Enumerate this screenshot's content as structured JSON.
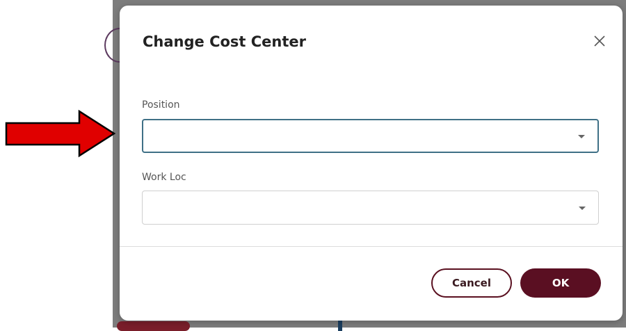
{
  "modal": {
    "title": "Change Cost Center",
    "close_icon": "close-icon",
    "fields": [
      {
        "label": "Position",
        "value": "",
        "focused": true
      },
      {
        "label": "Work Loc",
        "value": "",
        "focused": false
      }
    ],
    "cancel_label": "Cancel",
    "ok_label": "OK",
    "accent_color": "#5a0f22",
    "focus_color": "#3f7086"
  },
  "annotation": {
    "arrow_icon": "red-arrow-icon",
    "arrow_color": "#e00000"
  }
}
